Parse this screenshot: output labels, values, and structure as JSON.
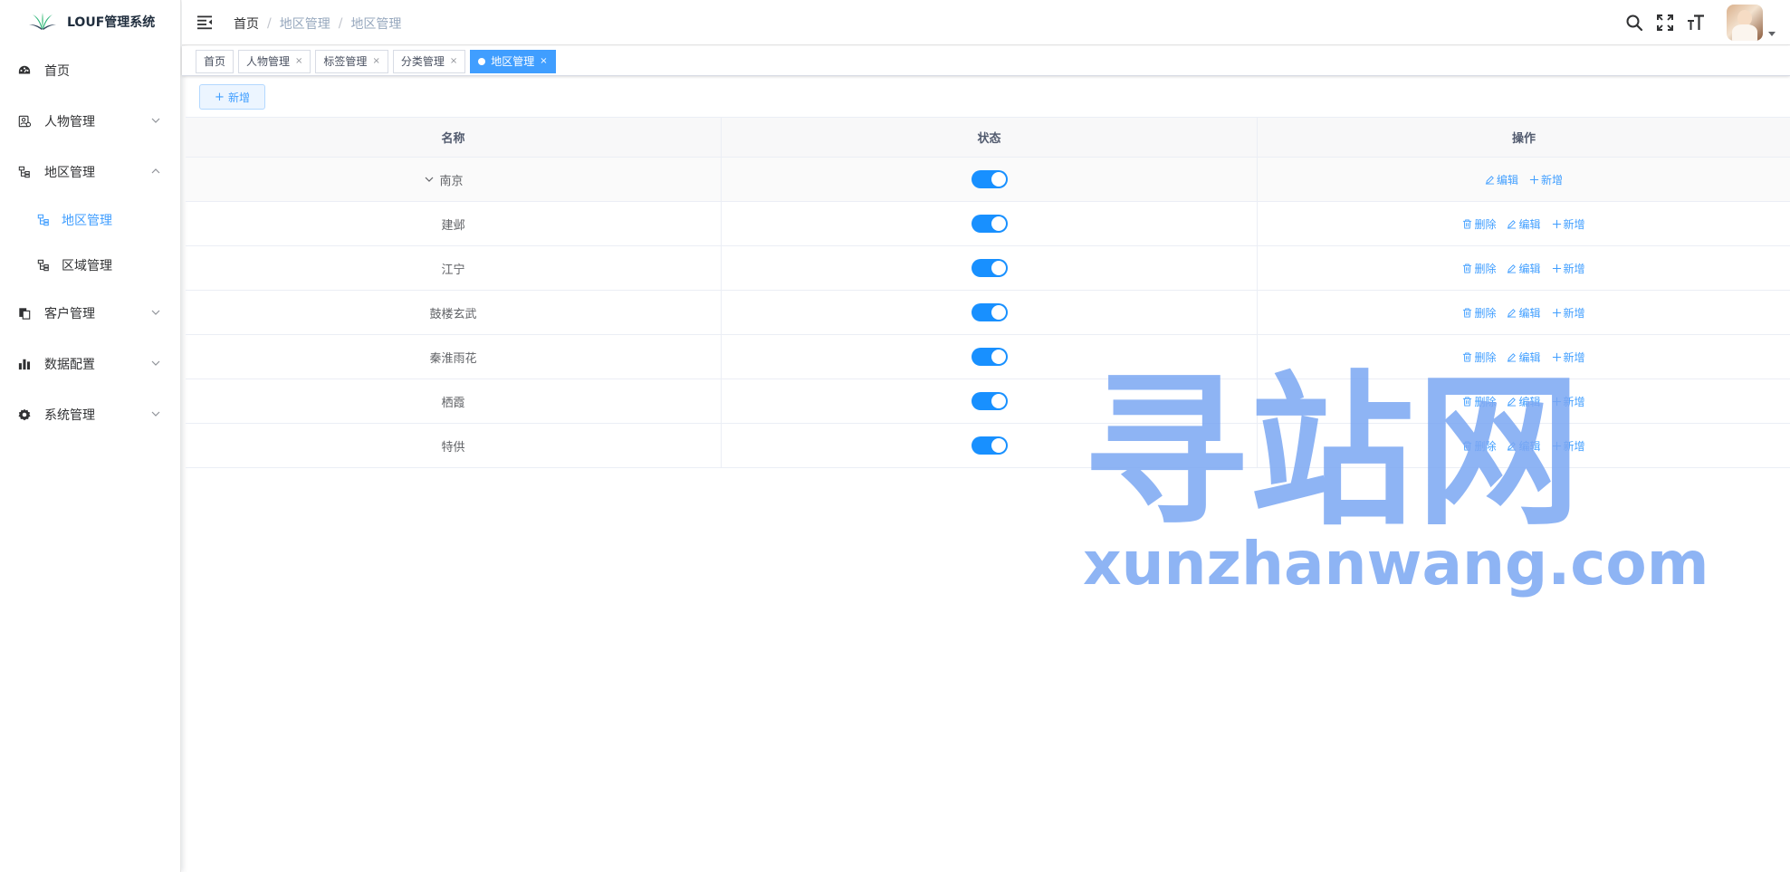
{
  "app": {
    "title": "LOUF管理系统"
  },
  "sidebar": {
    "items": [
      {
        "label": "首页",
        "icon": "dashboard-icon"
      },
      {
        "label": "人物管理",
        "icon": "user-manage-icon"
      },
      {
        "label": "地区管理",
        "icon": "tree-icon",
        "expanded": true,
        "children": [
          {
            "label": "地区管理",
            "active": true
          },
          {
            "label": "区域管理"
          }
        ]
      },
      {
        "label": "客户管理",
        "icon": "customer-icon"
      },
      {
        "label": "数据配置",
        "icon": "chart-icon"
      },
      {
        "label": "系统管理",
        "icon": "gear-icon"
      }
    ]
  },
  "navbar": {
    "breadcrumb": [
      "首页",
      "地区管理",
      "地区管理"
    ],
    "breadcrumb_sep": "/"
  },
  "tags": [
    {
      "label": "首页",
      "closable": false
    },
    {
      "label": "人物管理",
      "closable": true
    },
    {
      "label": "标签管理",
      "closable": true
    },
    {
      "label": "分类管理",
      "closable": true
    },
    {
      "label": "地区管理",
      "closable": true,
      "active": true
    }
  ],
  "tag_close": "×",
  "toolbar": {
    "add_label": "新增",
    "add_icon": "+"
  },
  "table": {
    "headers": {
      "name": "名称",
      "status": "状态",
      "ops": "操作"
    },
    "rows": [
      {
        "name": "南京",
        "status_on": true,
        "level": "parent"
      },
      {
        "name": "建邺",
        "status_on": true,
        "level": "child"
      },
      {
        "name": "江宁",
        "status_on": true,
        "level": "child"
      },
      {
        "name": "鼓楼玄武",
        "status_on": true,
        "level": "child"
      },
      {
        "name": "秦淮雨花",
        "status_on": true,
        "level": "child"
      },
      {
        "name": "栖霞",
        "status_on": true,
        "level": "child"
      },
      {
        "name": "特供",
        "status_on": true,
        "level": "child"
      }
    ],
    "op_labels": {
      "delete": "删除",
      "edit": "编辑",
      "add": "新增"
    }
  },
  "watermark": {
    "big": "寻站网",
    "small": "xunzhanwang.com"
  },
  "colors": {
    "primary": "#409eff",
    "switch_on": "#1890ff",
    "tag_active": "#409eff",
    "watermark": "#7ba7f3"
  }
}
